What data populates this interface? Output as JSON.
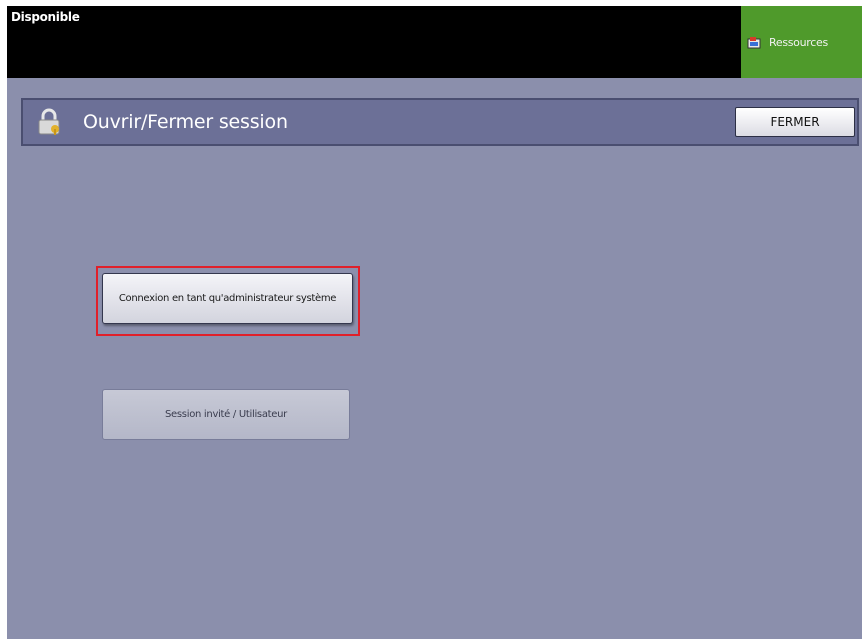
{
  "topbar": {
    "status_text": "Disponible",
    "resources_button": {
      "label": "Ressources",
      "icon": "resources-icon"
    }
  },
  "panel": {
    "title": "Ouvrir/Fermer session",
    "icon": "lock-icon",
    "close_label": "FERMER"
  },
  "options": {
    "login_label": "Connexion en tant qu'administrateur système",
    "guest_label": "Session invité / Utilisateur"
  },
  "colors": {
    "background": "#8b8fac",
    "topbar": "#000000",
    "resources_button": "#4f9a2b",
    "panel_header": "#6c7097",
    "selection_outline": "#e0202a"
  }
}
